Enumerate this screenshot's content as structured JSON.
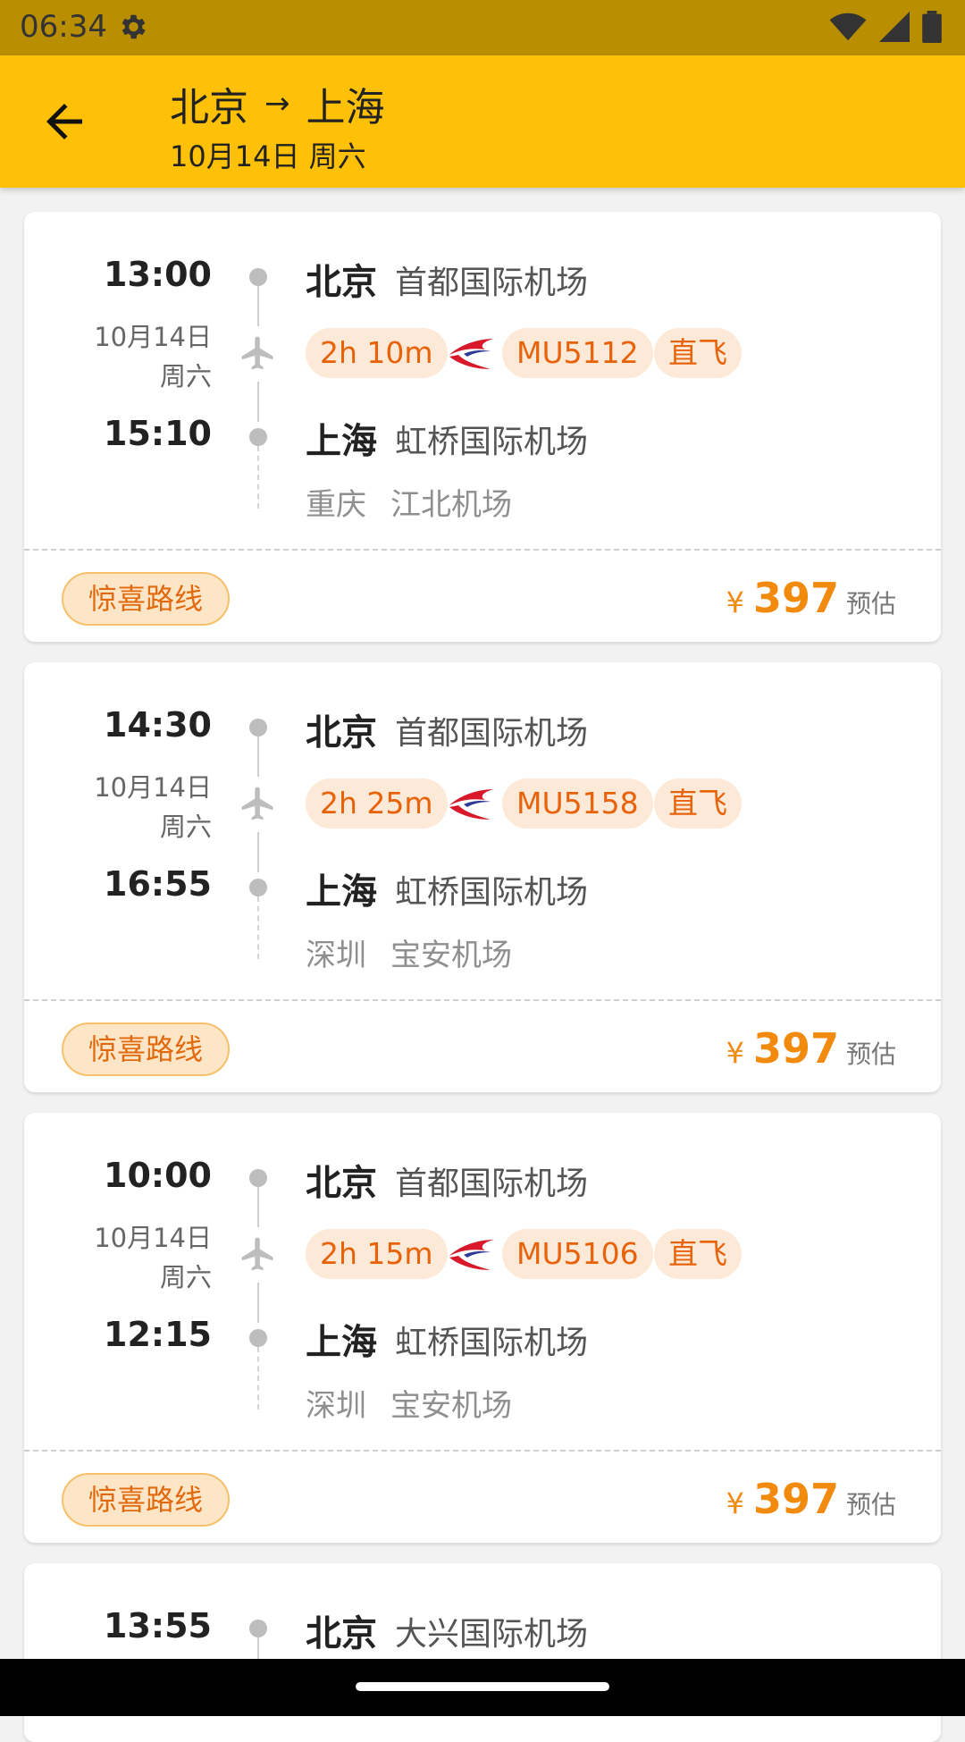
{
  "status": {
    "time": "06:34"
  },
  "header": {
    "from": "北京",
    "arrow": "→",
    "to": "上海",
    "date": "10月14日 周六"
  },
  "colors": {
    "appbar": "#ffc107",
    "statusbar": "#b98e00",
    "accent": "#f28a0e",
    "chip_bg": "#fde9d7",
    "chip_text": "#e8620a"
  },
  "flights": [
    {
      "dep_time": "13:00",
      "date": "10月14日",
      "weekday": "周六",
      "arr_time": "15:10",
      "dep_city": "北京",
      "dep_airport": "首都国际机场",
      "duration": "2h 10m",
      "flight_no": "MU5112",
      "type": "直飞",
      "arr_city": "上海",
      "arr_airport": "虹桥国际机场",
      "via_city": "重庆",
      "via_airport": "江北机场",
      "tag": "惊喜路线",
      "currency": "¥",
      "price": "397",
      "price_note": "预估"
    },
    {
      "dep_time": "14:30",
      "date": "10月14日",
      "weekday": "周六",
      "arr_time": "16:55",
      "dep_city": "北京",
      "dep_airport": "首都国际机场",
      "duration": "2h 25m",
      "flight_no": "MU5158",
      "type": "直飞",
      "arr_city": "上海",
      "arr_airport": "虹桥国际机场",
      "via_city": "深圳",
      "via_airport": "宝安机场",
      "tag": "惊喜路线",
      "currency": "¥",
      "price": "397",
      "price_note": "预估"
    },
    {
      "dep_time": "10:00",
      "date": "10月14日",
      "weekday": "周六",
      "arr_time": "12:15",
      "dep_city": "北京",
      "dep_airport": "首都国际机场",
      "duration": "2h 15m",
      "flight_no": "MU5106",
      "type": "直飞",
      "arr_city": "上海",
      "arr_airport": "虹桥国际机场",
      "via_city": "深圳",
      "via_airport": "宝安机场",
      "tag": "惊喜路线",
      "currency": "¥",
      "price": "397",
      "price_note": "预估"
    },
    {
      "dep_time": "13:55",
      "dep_city": "北京",
      "dep_airport": "大兴国际机场"
    }
  ]
}
